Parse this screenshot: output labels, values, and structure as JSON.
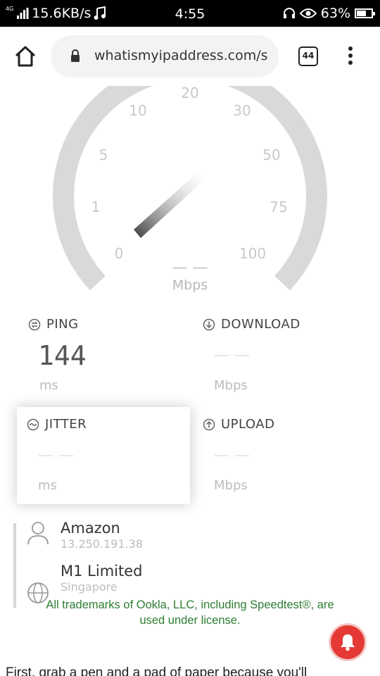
{
  "status_bar": {
    "network_type": "4G",
    "speed": "15.6KB/s",
    "time": "4:55",
    "battery": "63%",
    "battery_level": 0.63
  },
  "browser": {
    "url": "whatismyipaddress.com/s",
    "tab_count": "44"
  },
  "gauge": {
    "labels": [
      "0",
      "1",
      "5",
      "10",
      "20",
      "30",
      "50",
      "75",
      "100"
    ],
    "value": "— —",
    "unit": "Mbps"
  },
  "metrics": {
    "ping": {
      "label": "PING",
      "value": "144",
      "unit": "ms"
    },
    "download": {
      "label": "DOWNLOAD",
      "value": "— —",
      "unit": "Mbps"
    },
    "jitter": {
      "label": "JITTER",
      "value": "— —",
      "unit": "ms"
    },
    "upload": {
      "label": "UPLOAD",
      "value": "— —",
      "unit": "Mbps"
    }
  },
  "provider": {
    "isp_name": "Amazon",
    "ip": "13.250.191.38",
    "server_name": "M1 Limited",
    "server_location": "Singapore"
  },
  "trademark_line1": "All trademarks of Ookla, LLC, including Speedtest®, are",
  "trademark_line2": "used under license.",
  "article_text": "First, grab a pen and a pad of paper because you'll",
  "colors": {
    "accent_red": "#e53935",
    "trademark_green": "#2e7d32",
    "gauge_track": "#d9d9d9"
  }
}
